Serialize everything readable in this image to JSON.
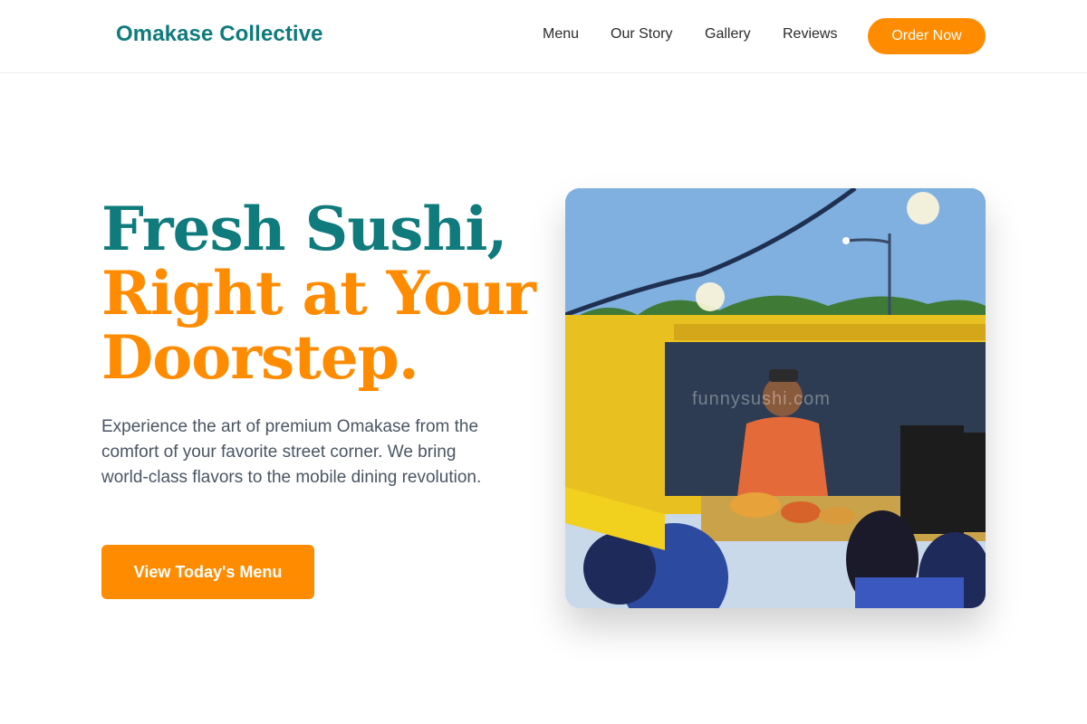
{
  "header": {
    "brand": "Omakase Collective",
    "nav": [
      "Menu",
      "Our Story",
      "Gallery",
      "Reviews"
    ],
    "cta_label": "Order Now"
  },
  "hero": {
    "title_line1": "Fresh Sushi,",
    "title_line2": "Right at Your",
    "title_line3": "Doorstep.",
    "description": "Experience the art of premium Omakase from the comfort of your favorite street corner. We bring world-class flavors to the mobile dining revolution.",
    "button_label": "View Today's Menu",
    "image_watermark": "funnysushi.com"
  },
  "colors": {
    "brand_teal": "#0f7b7c",
    "accent_orange": "#ff8c00",
    "body_text": "#4a5563"
  }
}
